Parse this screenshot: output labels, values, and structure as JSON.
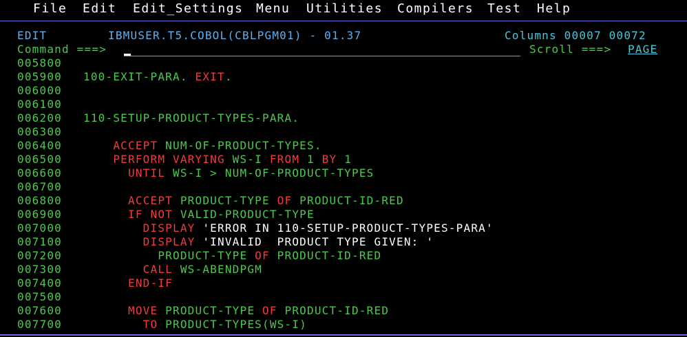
{
  "menu": [
    {
      "label": "File"
    },
    {
      "label": "Edit"
    },
    {
      "label": "Edit_Settings"
    },
    {
      "label": "Menu"
    },
    {
      "label": "Utilities"
    },
    {
      "label": "Compilers"
    },
    {
      "label": "Test"
    },
    {
      "label": "Help"
    }
  ],
  "header": {
    "mode": "EDIT",
    "dataset": "IBMUSER.T5.COBOL(CBLPGM01) - 01.37",
    "columns": "Columns 00007 00072",
    "command_label": "Command ===>",
    "command_value": "",
    "scroll_label": "Scroll ===>",
    "scroll_value": "PAGE"
  },
  "lines": [
    {
      "num": "005800",
      "segs": []
    },
    {
      "num": "005900",
      "segs": [
        {
          "t": "100-EXIT-PARA. ",
          "c": "green"
        },
        {
          "t": "EXIT",
          "c": "red"
        },
        {
          "t": ".",
          "c": "green"
        }
      ]
    },
    {
      "num": "006000",
      "segs": []
    },
    {
      "num": "006100",
      "segs": []
    },
    {
      "num": "006200",
      "segs": [
        {
          "t": "110-SETUP-PRODUCT-TYPES-PARA.",
          "c": "green"
        }
      ]
    },
    {
      "num": "006300",
      "segs": []
    },
    {
      "num": "006400",
      "segs": [
        {
          "t": "    ",
          "c": "green"
        },
        {
          "t": "ACCEPT",
          "c": "red"
        },
        {
          "t": " NUM-OF-PRODUCT-TYPES.",
          "c": "green"
        }
      ]
    },
    {
      "num": "006500",
      "segs": [
        {
          "t": "    ",
          "c": "green"
        },
        {
          "t": "PERFORM VARYING",
          "c": "red"
        },
        {
          "t": " WS-I ",
          "c": "green"
        },
        {
          "t": "FROM",
          "c": "red"
        },
        {
          "t": " 1 ",
          "c": "green"
        },
        {
          "t": "BY",
          "c": "red"
        },
        {
          "t": " 1",
          "c": "green"
        }
      ]
    },
    {
      "num": "006600",
      "segs": [
        {
          "t": "      ",
          "c": "green"
        },
        {
          "t": "UNTIL",
          "c": "red"
        },
        {
          "t": " WS-I > NUM-OF-PRODUCT-TYPES",
          "c": "green"
        }
      ]
    },
    {
      "num": "006700",
      "segs": []
    },
    {
      "num": "006800",
      "segs": [
        {
          "t": "      ",
          "c": "green"
        },
        {
          "t": "ACCEPT",
          "c": "red"
        },
        {
          "t": " PRODUCT-TYPE ",
          "c": "green"
        },
        {
          "t": "OF",
          "c": "red"
        },
        {
          "t": " PRODUCT-ID-RED",
          "c": "green"
        }
      ]
    },
    {
      "num": "006900",
      "segs": [
        {
          "t": "      ",
          "c": "green"
        },
        {
          "t": "IF NOT",
          "c": "red"
        },
        {
          "t": " VALID-PRODUCT-TYPE",
          "c": "green"
        }
      ]
    },
    {
      "num": "007000",
      "segs": [
        {
          "t": "        ",
          "c": "green"
        },
        {
          "t": "DISPLAY",
          "c": "red"
        },
        {
          "t": " 'ERROR IN 110-SETUP-PRODUCT-TYPES-PARA'",
          "c": "white"
        }
      ]
    },
    {
      "num": "007100",
      "segs": [
        {
          "t": "        ",
          "c": "green"
        },
        {
          "t": "DISPLAY",
          "c": "red"
        },
        {
          "t": " 'INVALID  PRODUCT TYPE GIVEN: '",
          "c": "white"
        }
      ]
    },
    {
      "num": "007200",
      "segs": [
        {
          "t": "          PRODUCT-TYPE ",
          "c": "green"
        },
        {
          "t": "OF",
          "c": "red"
        },
        {
          "t": " PRODUCT-ID-RED",
          "c": "green"
        }
      ]
    },
    {
      "num": "007300",
      "segs": [
        {
          "t": "        ",
          "c": "green"
        },
        {
          "t": "CALL",
          "c": "red"
        },
        {
          "t": " WS-ABENDPGM",
          "c": "green"
        }
      ]
    },
    {
      "num": "007400",
      "segs": [
        {
          "t": "      ",
          "c": "green"
        },
        {
          "t": "END-IF",
          "c": "red"
        }
      ]
    },
    {
      "num": "007500",
      "segs": []
    },
    {
      "num": "007600",
      "segs": [
        {
          "t": "      ",
          "c": "green"
        },
        {
          "t": "MOVE",
          "c": "red"
        },
        {
          "t": " PRODUCT-TYPE ",
          "c": "green"
        },
        {
          "t": "OF",
          "c": "red"
        },
        {
          "t": " PRODUCT-ID-RED",
          "c": "green"
        }
      ]
    },
    {
      "num": "007700",
      "segs": [
        {
          "t": "        ",
          "c": "green"
        },
        {
          "t": "TO",
          "c": "red"
        },
        {
          "t": " PRODUCT-TYPES(WS-I)",
          "c": "green"
        }
      ]
    }
  ]
}
